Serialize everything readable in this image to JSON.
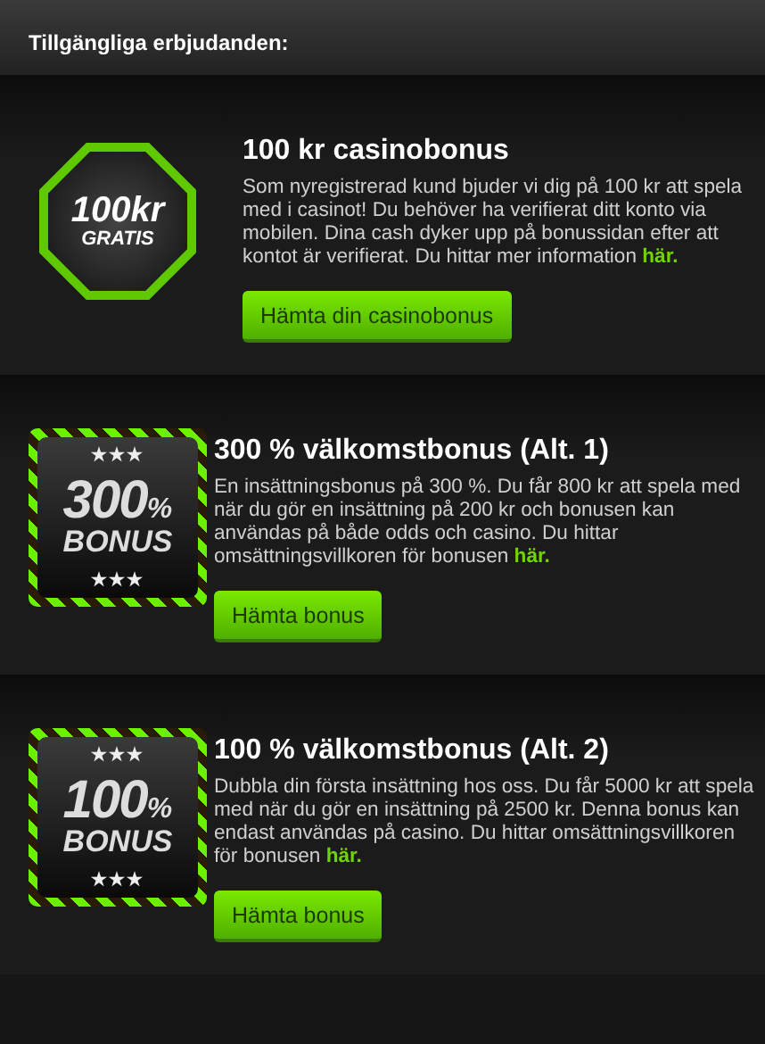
{
  "header": {
    "title": "Tillgängliga erbjudanden:"
  },
  "offers": [
    {
      "badge": {
        "kind": "octagon",
        "amount": "100kr",
        "label": "GRATIS"
      },
      "title": "100 kr casinobonus",
      "description": "Som nyregistrerad kund bjuder vi dig på 100 kr att spela med i casinot! Du behöver ha verifierat ditt konto via mobilen. Dina cash dyker upp på bonussidan efter att kontot är verifierat. Du hittar mer information",
      "link": "här.",
      "button": "Hämta din casinobonus"
    },
    {
      "badge": {
        "kind": "striped",
        "stars_top": "★★★",
        "amount": "300",
        "unit": "%",
        "label": "BONUS",
        "stars_bottom": "★★★"
      },
      "title": "300 % välkomstbonus (Alt. 1)",
      "description": "En insättningsbonus på 300 %. Du får 800 kr att spela med när du gör en insättning på 200 kr och bonusen kan användas på både odds och casino. Du hittar omsättningsvillkoren för bonusen",
      "link": "här.",
      "button": "Hämta bonus"
    },
    {
      "badge": {
        "kind": "striped",
        "stars_top": "★★★",
        "amount": "100",
        "unit": "%",
        "label": "BONUS",
        "stars_bottom": "★★★"
      },
      "title": "100 % välkomstbonus (Alt. 2)",
      "description": "Dubbla din första insättning hos oss. Du får 5000 kr att spela med när du gör en insättning på 2500 kr. Denna bonus kan endast användas på casino. Du hittar omsättningsvillkoren för bonusen",
      "link": "här.",
      "button": "Hämta bonus"
    }
  ]
}
